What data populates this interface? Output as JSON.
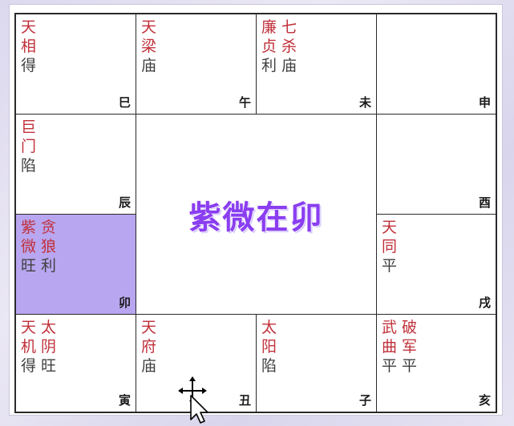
{
  "title": "紫微在卯",
  "colors": {
    "star": "#c0303a",
    "status": "#404040",
    "highlight": "#b8a6f0",
    "title": "#8a3ef0"
  },
  "palaces": [
    {
      "branch": "巳",
      "stars": [
        {
          "chars": [
            "天",
            "相"
          ],
          "status": "得"
        }
      ]
    },
    {
      "branch": "午",
      "stars": [
        {
          "chars": [
            "天",
            "梁"
          ],
          "status": "庙"
        }
      ]
    },
    {
      "branch": "未",
      "stars": [
        {
          "chars": [
            "廉",
            "贞"
          ],
          "status": "利"
        },
        {
          "chars": [
            "七",
            "杀"
          ],
          "status": "庙"
        }
      ]
    },
    {
      "branch": "申",
      "stars": []
    },
    {
      "branch": "辰",
      "stars": [
        {
          "chars": [
            "巨",
            "门"
          ],
          "status": "陷"
        }
      ]
    },
    {
      "branch": "酉",
      "stars": []
    },
    {
      "branch": "卯",
      "highlight": true,
      "stars": [
        {
          "chars": [
            "紫",
            "微"
          ],
          "status": "旺"
        },
        {
          "chars": [
            "贪",
            "狼"
          ],
          "status": "利"
        }
      ]
    },
    {
      "branch": "戌",
      "stars": [
        {
          "chars": [
            "天",
            "同"
          ],
          "status": "平"
        }
      ]
    },
    {
      "branch": "寅",
      "stars": [
        {
          "chars": [
            "天",
            "机"
          ],
          "status": "得"
        },
        {
          "chars": [
            "太",
            "阴"
          ],
          "status": "旺"
        }
      ]
    },
    {
      "branch": "丑",
      "stars": [
        {
          "chars": [
            "天",
            "府"
          ],
          "status": "庙"
        }
      ]
    },
    {
      "branch": "子",
      "stars": [
        {
          "chars": [
            "太",
            "阳"
          ],
          "status": "陷"
        }
      ]
    },
    {
      "branch": "亥",
      "stars": [
        {
          "chars": [
            "武",
            "曲"
          ],
          "status": "平"
        },
        {
          "chars": [
            "破",
            "军"
          ],
          "status": "平"
        }
      ]
    }
  ]
}
